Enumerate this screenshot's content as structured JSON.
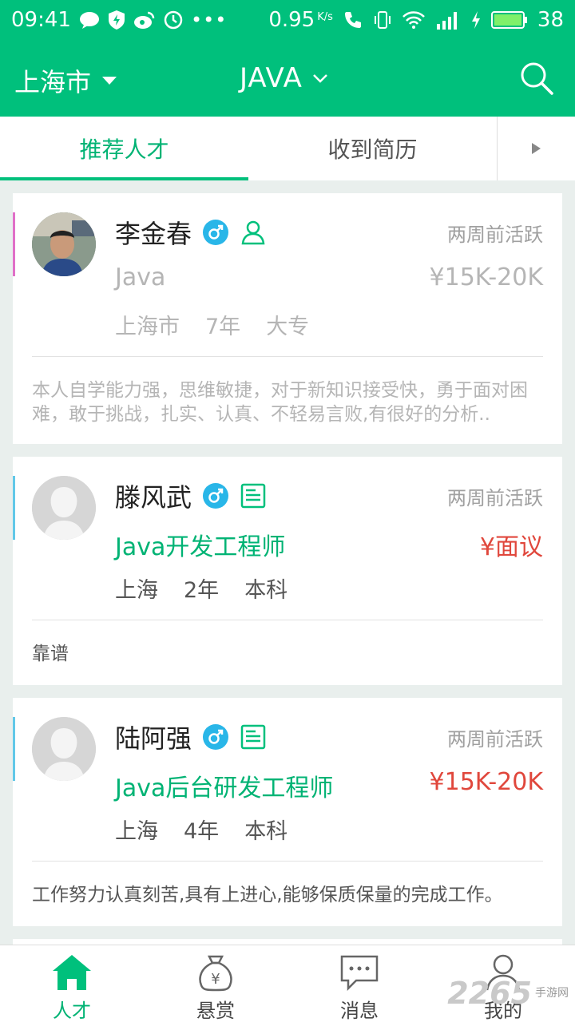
{
  "status_bar": {
    "time": "09:41",
    "speed": "0.95",
    "speed_unit": "K/s",
    "battery": "38"
  },
  "header": {
    "city": "上海市",
    "keyword": "JAVA"
  },
  "tabs": [
    {
      "label": "推荐人才",
      "active": true
    },
    {
      "label": "收到简历",
      "active": false
    }
  ],
  "candidates": [
    {
      "name": "李金春",
      "active_time": "两周前活跃",
      "position": "Java",
      "salary": "¥15K-20K",
      "city": "上海市",
      "experience": "7年",
      "education": "大专",
      "description": "本人自学能力强，思维敏捷，对于新知识接受快，勇于面对困难，敢于挑战，扎实、认真、不轻易言败,有很好的分析..",
      "tag_icon": "person-outline-icon",
      "accent_color": "#e070c8"
    },
    {
      "name": "滕风武",
      "active_time": "两周前活跃",
      "position": "Java开发工程师",
      "salary": "¥面议",
      "city": "上海",
      "experience": "2年",
      "education": "本科",
      "description": "靠谱",
      "tag_icon": "resume-card-icon",
      "accent_color": "#62c8e8"
    },
    {
      "name": "陆阿强",
      "active_time": "两周前活跃",
      "position": "Java后台研发工程师",
      "salary": "¥15K-20K",
      "city": "上海",
      "experience": "4年",
      "education": "本科",
      "description": "工作努力认真刻苦,具有上进心,能够保质保量的完成工作。",
      "tag_icon": "resume-card-icon",
      "accent_color": "#62c8e8"
    }
  ],
  "bottom_nav": [
    {
      "label": "人才",
      "icon": "house-icon",
      "active": true
    },
    {
      "label": "悬赏",
      "icon": "money-bag-icon",
      "active": false
    },
    {
      "label": "消息",
      "icon": "chat-bubble-icon",
      "active": false
    },
    {
      "label": "我的",
      "icon": "person-icon",
      "active": false
    }
  ],
  "watermark": {
    "number": "2265",
    "site": "手游网"
  },
  "colors": {
    "brand": "#00c07c",
    "salary_red": "#e0473c",
    "muted": "#a0a0a0"
  }
}
